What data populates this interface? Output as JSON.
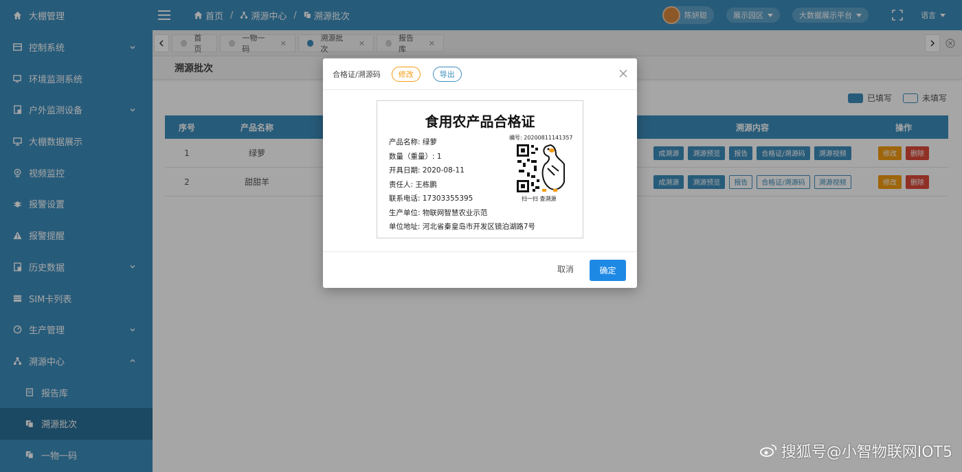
{
  "sidebar": {
    "items": [
      {
        "label": "大棚管理",
        "icon": "home-icon",
        "chevron": false
      },
      {
        "label": "控制系统",
        "icon": "grid-icon",
        "chevron": true
      },
      {
        "label": "环境监测系统",
        "icon": "monitor-edit-icon",
        "chevron": false
      },
      {
        "label": "户外监测设备",
        "icon": "device-icon",
        "chevron": true
      },
      {
        "label": "大棚数据展示",
        "icon": "display-icon",
        "chevron": false
      },
      {
        "label": "视频监控",
        "icon": "camera-icon",
        "chevron": false
      },
      {
        "label": "报警设置",
        "icon": "bug-icon",
        "chevron": false
      },
      {
        "label": "报警提醒",
        "icon": "warning-icon",
        "chevron": false
      },
      {
        "label": "历史数据",
        "icon": "history-icon",
        "chevron": true
      },
      {
        "label": "SIM卡列表",
        "icon": "sim-icon",
        "chevron": false
      },
      {
        "label": "生产管理",
        "icon": "gauge-icon",
        "chevron": true
      },
      {
        "label": "溯源中心",
        "icon": "sitemap-icon",
        "chevron": true,
        "expanded": true
      },
      {
        "label": "报告库",
        "icon": "doc-icon",
        "sub": true
      },
      {
        "label": "溯源批次",
        "icon": "copy-icon",
        "sub": true,
        "active": true
      },
      {
        "label": "一物一码",
        "icon": "copy-icon",
        "sub": true
      }
    ]
  },
  "header": {
    "breadcrumb": [
      "首页",
      "溯源中心",
      "溯源批次"
    ],
    "user": "陈妍聪",
    "park_select": "展示园区",
    "platform_select": "大数据展示平台",
    "language": "语言"
  },
  "tabs": [
    {
      "label": "首页",
      "closable": false
    },
    {
      "label": "一物一码",
      "closable": true
    },
    {
      "label": "溯源批次",
      "closable": true,
      "active": true
    },
    {
      "label": "报告库",
      "closable": true
    }
  ],
  "page": {
    "title": "溯源批次",
    "legend_filled": "已填写",
    "legend_empty": "未填写"
  },
  "table": {
    "headers": {
      "idx": "序号",
      "name": "产品名称",
      "src": "溯源内容",
      "op": "操作"
    },
    "rows": [
      {
        "idx": "1",
        "name": "绿萝"
      },
      {
        "idx": "2",
        "name": "甜甜羊"
      }
    ],
    "src_buttons": [
      "成溯源",
      "溯源预览",
      "报告",
      "合格证/溯源码",
      "溯源视频"
    ],
    "op_buttons": [
      "修改",
      "删除"
    ]
  },
  "modal": {
    "title": "合格证/溯源码",
    "edit_label": "修改",
    "export_label": "导出",
    "cancel_label": "取消",
    "ok_label": "确定",
    "cert": {
      "title": "食用农产品合格证",
      "number": "编号: 20200811141357",
      "lines": [
        "产品名称: 绿萝",
        "数量（重量）: 1",
        "开具日期: 2020-08-11",
        "责任人: 王栋鹏",
        "联系电话: 17303355395",
        "生产单位: 物联网智慧农业示范",
        "单位地址: 河北省秦皇岛市开发区镜泊湖路7号"
      ],
      "qr_caption": "扫一扫 查溯源"
    }
  },
  "watermark": "搜狐号@小智物联网IOT5",
  "colors": {
    "primary": "#3c8dbc",
    "orange": "#f39c12",
    "red": "#dd4b39",
    "ok": "#1e88e5"
  }
}
